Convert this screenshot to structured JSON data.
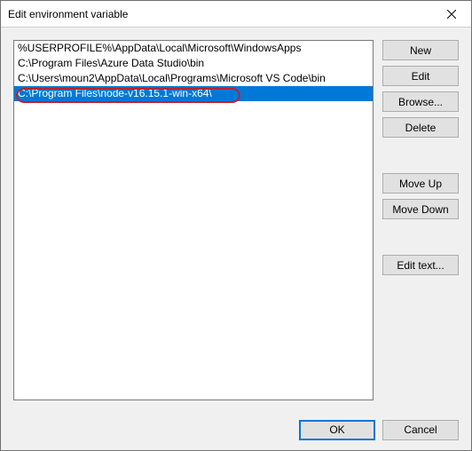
{
  "window": {
    "title": "Edit environment variable"
  },
  "list": {
    "items": [
      "%USERPROFILE%\\AppData\\Local\\Microsoft\\WindowsApps",
      "C:\\Program Files\\Azure Data Studio\\bin",
      "C:\\Users\\moun2\\AppData\\Local\\Programs\\Microsoft VS Code\\bin",
      "C:\\Program Files\\node-v16.15.1-win-x64\\"
    ],
    "selected_index": 3
  },
  "buttons": {
    "new": "New",
    "edit": "Edit",
    "browse": "Browse...",
    "delete": "Delete",
    "move_up": "Move Up",
    "move_down": "Move Down",
    "edit_text": "Edit text...",
    "ok": "OK",
    "cancel": "Cancel"
  }
}
